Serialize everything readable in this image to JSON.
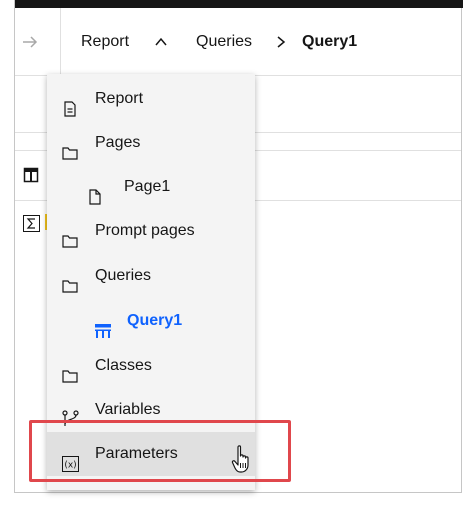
{
  "header": {
    "back_icon": "arrow-right-icon",
    "breadcrumbs": [
      {
        "label": "Report",
        "icon": "chevron-up-icon"
      },
      {
        "label": "Queries",
        "icon": "chevron-right-icon"
      },
      {
        "label": "Query1"
      }
    ]
  },
  "menu": {
    "items": [
      {
        "label": "Report",
        "icon": "document-icon"
      },
      {
        "label": "Pages",
        "icon": "folder-icon"
      },
      {
        "label": "Page1",
        "icon": "page-icon"
      },
      {
        "label": "Prompt pages",
        "icon": "folder-icon"
      },
      {
        "label": "Queries",
        "icon": "folder-icon"
      },
      {
        "label": "Query1",
        "icon": "query-table-icon",
        "selected": true
      },
      {
        "label": "Classes",
        "icon": "folder-icon"
      },
      {
        "label": "Variables",
        "icon": "branch-icon"
      },
      {
        "label": "Parameters",
        "icon": "parameter-icon",
        "hovered": true
      }
    ]
  },
  "colors": {
    "accent": "#0f62fe",
    "highlight": "#e0474c",
    "menu_bg": "#f4f4f4",
    "hover_bg": "#e0e0e0"
  }
}
